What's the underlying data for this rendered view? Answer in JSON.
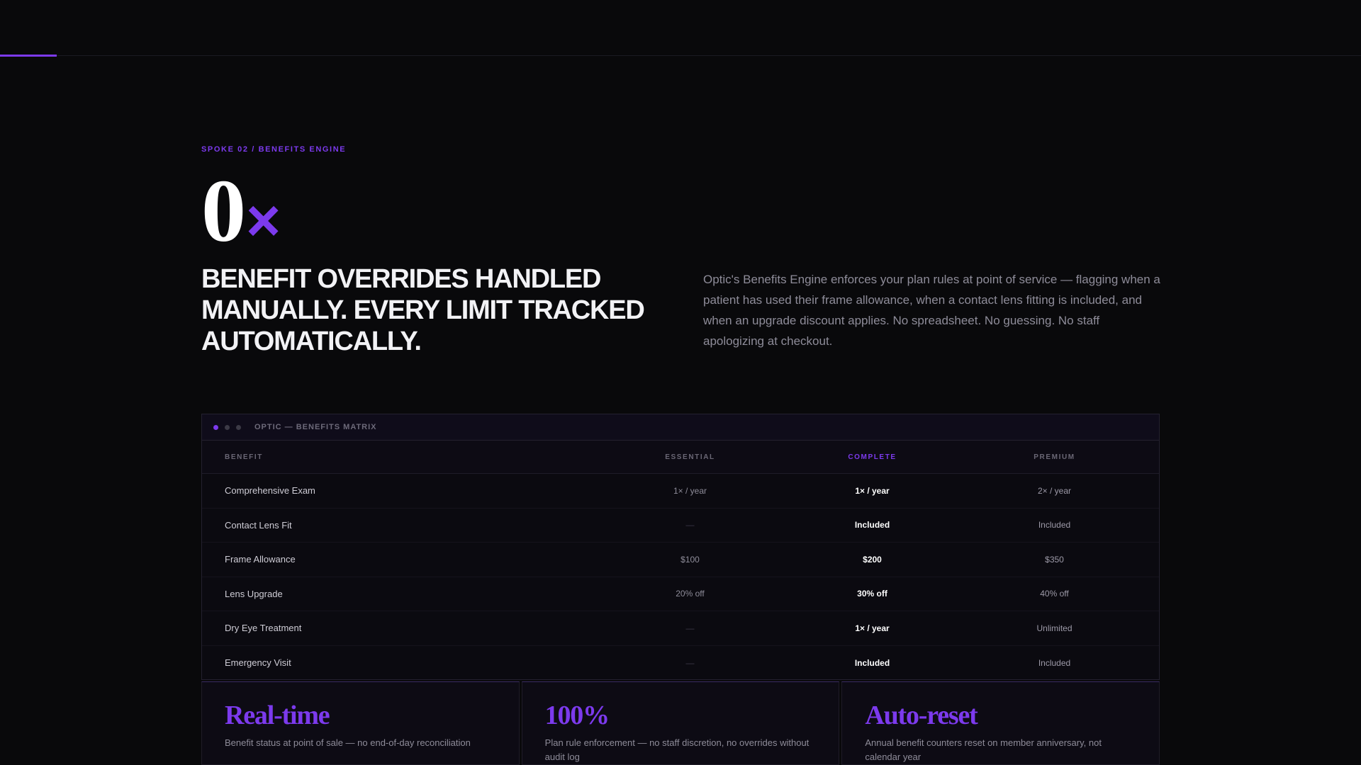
{
  "section": {
    "eyebrow": "SPOKE 02 / BENEFITS ENGINE",
    "stat_number": "0",
    "stat_suffix": "×",
    "headline": "BENEFIT OVERRIDES HANDLED MANUALLY. EVERY LIMIT TRACKED AUTOMATICALLY.",
    "description": "Optic's Benefits Engine enforces your plan rules at point of service — flagging when a patient has used their frame allowance, when a contact lens fitting is included, and when an upgrade discount applies. No spreadsheet. No guessing. No staff apologizing at checkout."
  },
  "matrix": {
    "title": "OPTIC — BENEFITS MATRIX",
    "columns": [
      "BENEFIT",
      "ESSENTIAL",
      "COMPLETE",
      "PREMIUM"
    ],
    "rows": [
      [
        "Comprehensive Exam",
        "1× / year",
        "1× / year",
        "2× / year"
      ],
      [
        "Contact Lens Fit",
        "—",
        "Included",
        "Included"
      ],
      [
        "Frame Allowance",
        "$100",
        "$200",
        "$350"
      ],
      [
        "Lens Upgrade",
        "20% off",
        "30% off",
        "40% off"
      ],
      [
        "Dry Eye Treatment",
        "—",
        "1× / year",
        "Unlimited"
      ],
      [
        "Emergency Visit",
        "—",
        "Included",
        "Included"
      ]
    ]
  },
  "stats": [
    {
      "value": "Real-time",
      "desc": "Benefit status at point of sale — no end-of-day reconciliation"
    },
    {
      "value": "100%",
      "desc": "Plan rule enforcement — no staff discretion, no overrides without audit log"
    },
    {
      "value": "Auto-reset",
      "desc": "Annual benefit counters reset on member anniversary, not calendar year"
    }
  ],
  "colors": {
    "accent": "#7c3aed",
    "background": "#09090b"
  }
}
